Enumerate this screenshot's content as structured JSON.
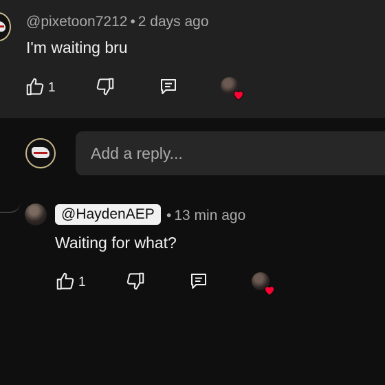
{
  "comment": {
    "author": "@pixetoon7212",
    "separator": "•",
    "time": "2 days ago",
    "text": "I'm waiting bru",
    "likes": "1",
    "icons": {
      "like": "thumbs-up-icon",
      "dislike": "thumbs-down-icon",
      "reply": "reply-comment-icon",
      "creator_heart": "creator-heart-icon"
    }
  },
  "reply_input": {
    "placeholder": "Add a reply..."
  },
  "reply": {
    "mention": "@HaydenAEP",
    "separator": "•",
    "time": "13 min ago",
    "text": "Waiting for what?",
    "likes": "1",
    "icons": {
      "like": "thumbs-up-icon",
      "dislike": "thumbs-down-icon",
      "reply": "reply-comment-icon",
      "creator_heart": "creator-heart-icon"
    }
  },
  "colors": {
    "background": "#0f0f0f",
    "comment_background": "#212121",
    "input_background": "#272727",
    "muted_text": "#aaaaaa",
    "heart": "#ff0033"
  }
}
